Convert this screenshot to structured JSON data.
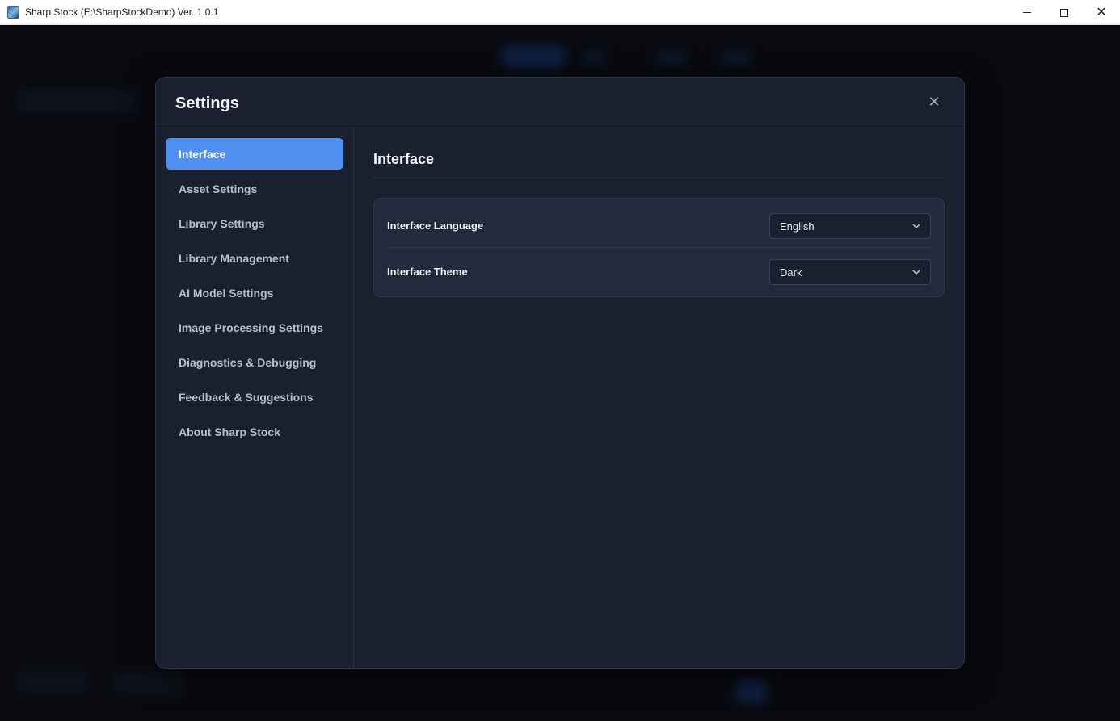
{
  "window": {
    "title": "Sharp Stock (E:\\SharpStockDemo) Ver. 1.0.1",
    "close_glyph": "✕"
  },
  "dialog": {
    "title": "Settings",
    "close_glyph": "✕"
  },
  "sidebar": {
    "items": [
      {
        "label": "Interface",
        "active": true
      },
      {
        "label": "Asset Settings",
        "active": false
      },
      {
        "label": "Library Settings",
        "active": false
      },
      {
        "label": "Library Management",
        "active": false
      },
      {
        "label": "AI Model Settings",
        "active": false
      },
      {
        "label": "Image Processing Settings",
        "active": false
      },
      {
        "label": "Diagnostics & Debugging",
        "active": false
      },
      {
        "label": "Feedback & Suggestions",
        "active": false
      },
      {
        "label": "About Sharp Stock",
        "active": false
      }
    ]
  },
  "content": {
    "title": "Interface",
    "rows": [
      {
        "label": "Interface Language",
        "value": "English"
      },
      {
        "label": "Interface Theme",
        "value": "Dark"
      }
    ]
  },
  "colors": {
    "accent": "#4f8ff0",
    "dialog_bg": "#1a2030",
    "card_bg": "#222a3b"
  },
  "icons": {
    "app": "app-logo-icon",
    "minimize": "minimize-icon",
    "maximize": "maximize-icon",
    "close": "close-icon",
    "dropdown": "chevron-down-icon"
  }
}
